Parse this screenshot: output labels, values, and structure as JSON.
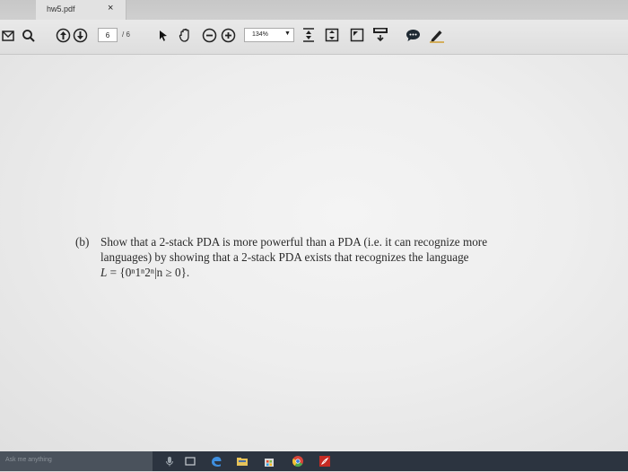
{
  "tab": {
    "title": "hw5.pdf",
    "close": "×"
  },
  "toolbar": {
    "page_current": "6",
    "page_total": "/ 6",
    "zoom": "134%",
    "zoom_caret": "▼"
  },
  "document": {
    "label": "(b)",
    "lines": [
      "Show that a 2-stack PDA is more powerful than a PDA (i.e. it can recognize more",
      "languages) by showing that a 2-stack PDA exists that recognizes the language"
    ],
    "math_lhs": "L",
    "math_rhs": " = {0ⁿ1ⁿ2ⁿ|n ≥ 0}."
  },
  "taskbar": {
    "search_placeholder": "Ask me anything"
  }
}
